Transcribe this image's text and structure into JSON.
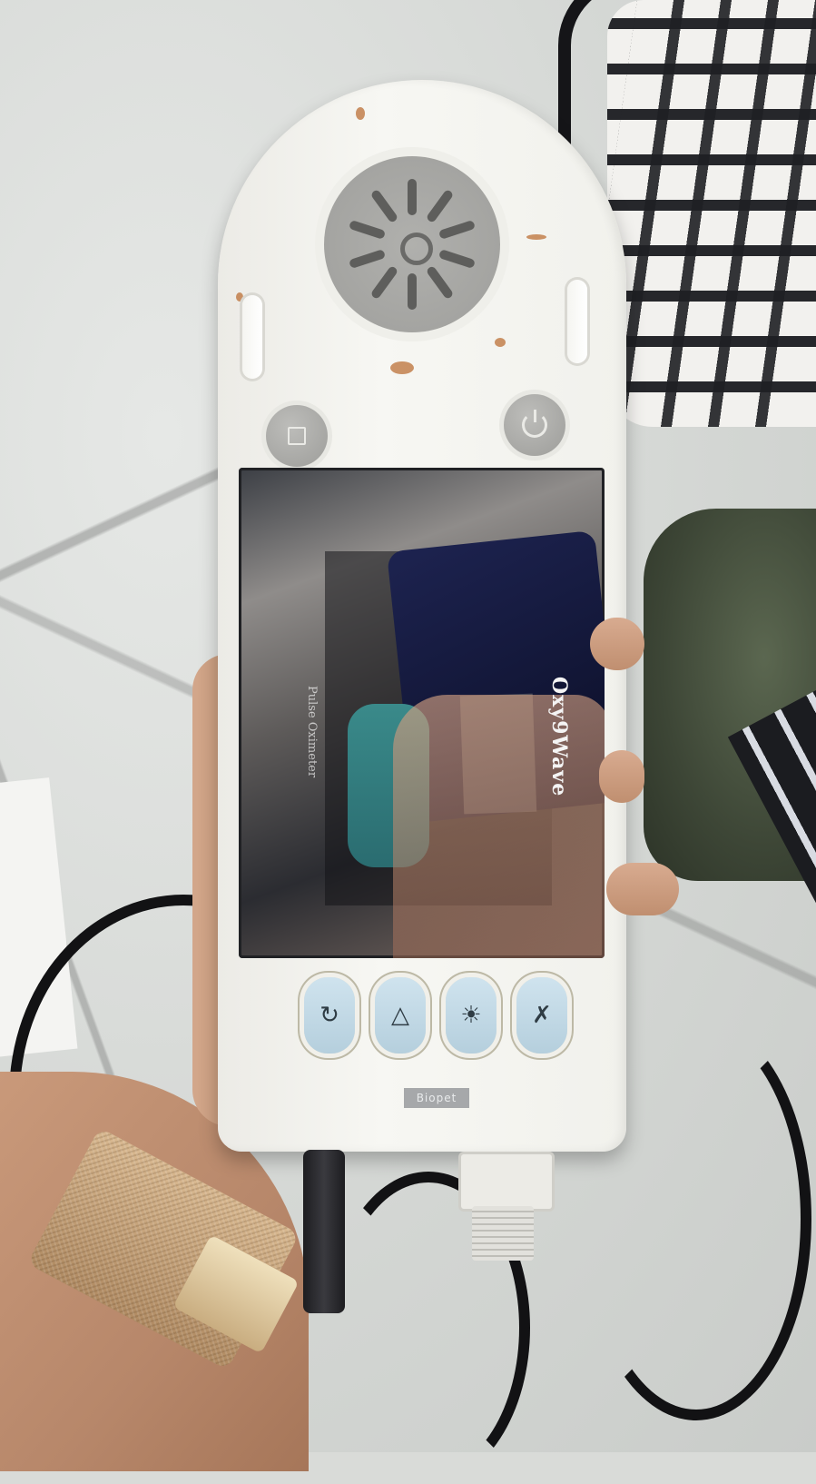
{
  "device": {
    "screen_brand": "Oxy9Wave",
    "screen_label": "Pulse Oximeter",
    "badge": "Biopet",
    "buttons": {
      "top_left": "stop-icon",
      "top_right": "power-icon",
      "soft": [
        "rotate-icon",
        "bell-icon",
        "brightness-icon",
        "mute-icon"
      ]
    }
  },
  "colors": {
    "body": "#f2f2ee",
    "speaker": "#a8a8a5",
    "soft_button": "#c4dbe7"
  }
}
